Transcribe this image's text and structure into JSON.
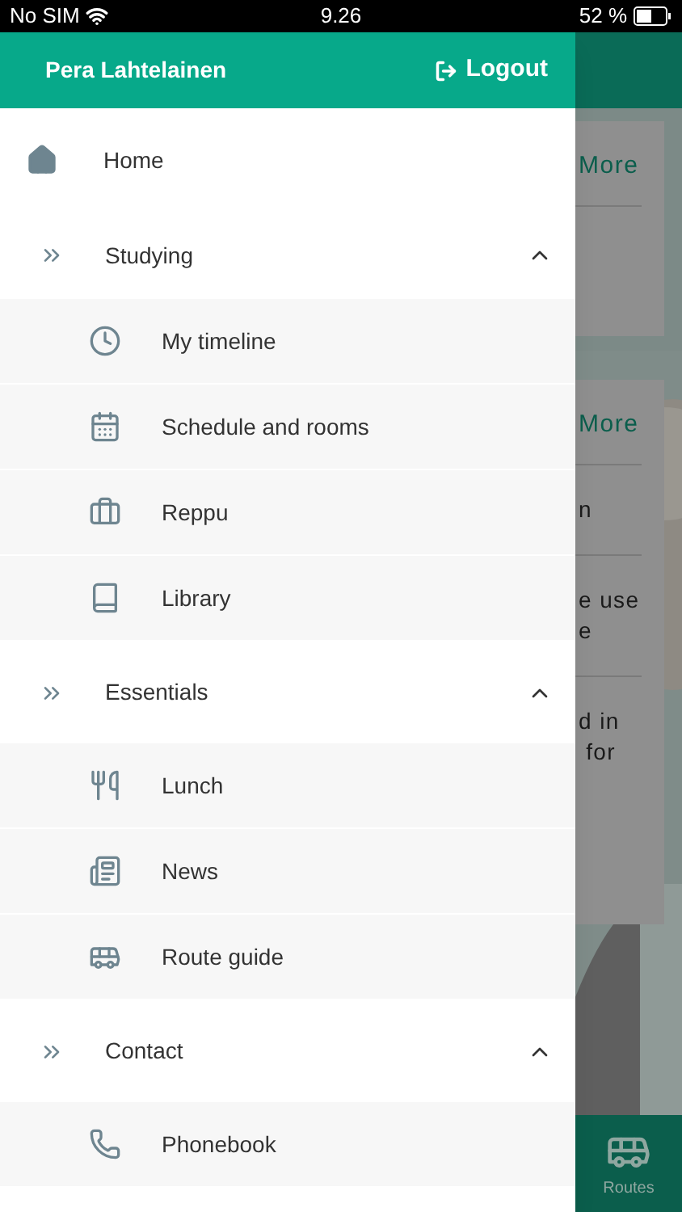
{
  "status_bar": {
    "carrier": "No SIM",
    "time": "9.26",
    "battery": "52 %"
  },
  "drawer": {
    "user": "Pera Lahtelainen",
    "logout": "Logout",
    "items": [
      {
        "kind": "link",
        "label": "Home"
      },
      {
        "kind": "section",
        "label": "Studying",
        "expanded": true,
        "children": [
          {
            "label": "My timeline"
          },
          {
            "label": "Schedule and rooms"
          },
          {
            "label": "Reppu"
          },
          {
            "label": "Library"
          }
        ]
      },
      {
        "kind": "section",
        "label": "Essentials",
        "expanded": true,
        "children": [
          {
            "label": "Lunch"
          },
          {
            "label": "News"
          },
          {
            "label": "Route guide"
          }
        ]
      },
      {
        "kind": "section",
        "label": "Contact",
        "expanded": true,
        "children": [
          {
            "label": "Phonebook"
          }
        ]
      }
    ]
  },
  "background": {
    "cards": [
      {
        "link": "More"
      },
      {
        "link": "More",
        "lines": [
          "n",
          "e use\ne",
          "d in\n for"
        ]
      }
    ],
    "tab": {
      "label": "Routes"
    }
  }
}
